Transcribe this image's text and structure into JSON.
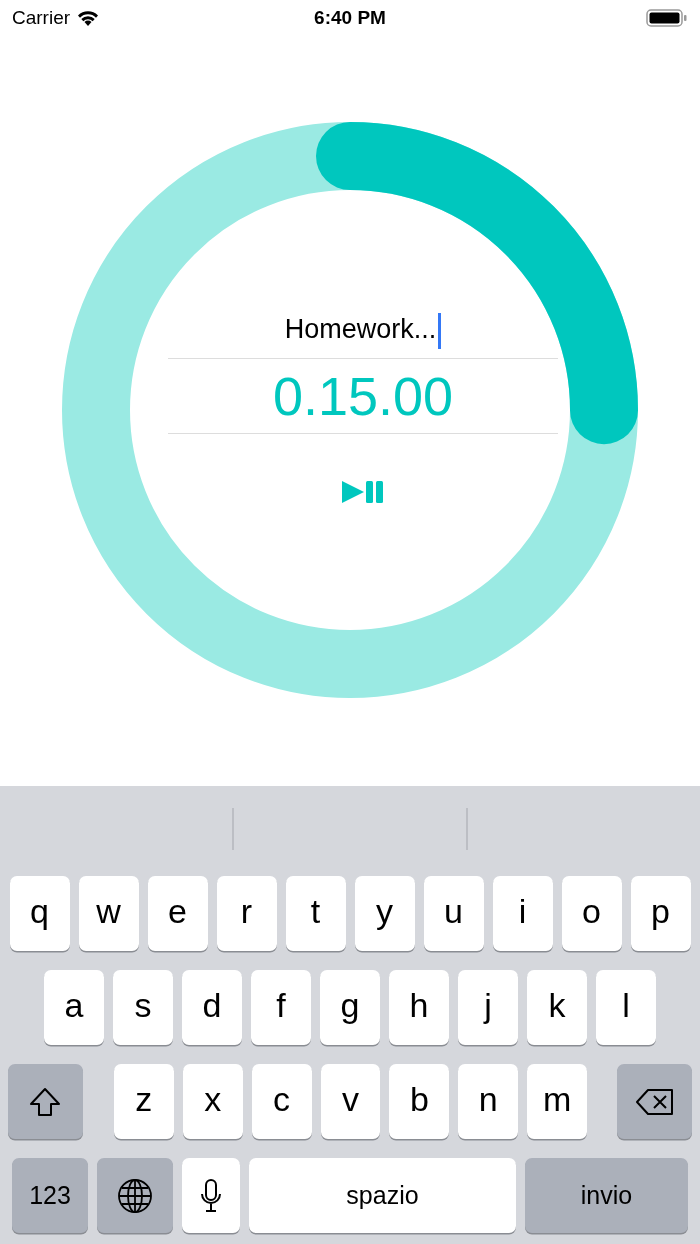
{
  "status_bar": {
    "carrier": "Carrier",
    "time": "6:40 PM"
  },
  "timer": {
    "task_field": {
      "value": "Homework...",
      "focused": true
    },
    "time": "0.15.00"
  },
  "keyboard": {
    "rows": [
      [
        {
          "kind": "letter",
          "label": "q"
        },
        {
          "kind": "letter",
          "label": "w"
        },
        {
          "kind": "letter",
          "label": "e"
        },
        {
          "kind": "letter",
          "label": "r"
        },
        {
          "kind": "letter",
          "label": "t"
        },
        {
          "kind": "letter",
          "label": "y"
        },
        {
          "kind": "letter",
          "label": "u"
        },
        {
          "kind": "letter",
          "label": "i"
        },
        {
          "kind": "letter",
          "label": "o"
        },
        {
          "kind": "letter",
          "label": "p"
        }
      ],
      [
        {
          "kind": "letter",
          "label": "a"
        },
        {
          "kind": "letter",
          "label": "s"
        },
        {
          "kind": "letter",
          "label": "d"
        },
        {
          "kind": "letter",
          "label": "f"
        },
        {
          "kind": "letter",
          "label": "g"
        },
        {
          "kind": "letter",
          "label": "h"
        },
        {
          "kind": "letter",
          "label": "j"
        },
        {
          "kind": "letter",
          "label": "k"
        },
        {
          "kind": "letter",
          "label": "l"
        }
      ],
      [
        {
          "kind": "shift"
        },
        {
          "kind": "letter",
          "label": "z"
        },
        {
          "kind": "letter",
          "label": "x"
        },
        {
          "kind": "letter",
          "label": "c"
        },
        {
          "kind": "letter",
          "label": "v"
        },
        {
          "kind": "letter",
          "label": "b"
        },
        {
          "kind": "letter",
          "label": "n"
        },
        {
          "kind": "letter",
          "label": "m"
        },
        {
          "kind": "backspace"
        }
      ]
    ],
    "bottom_row": [
      {
        "kind": "mode",
        "label": "123"
      },
      {
        "kind": "globe"
      },
      {
        "kind": "mic"
      },
      {
        "kind": "space",
        "label": "spazio"
      },
      {
        "kind": "return",
        "label": "invio"
      }
    ]
  }
}
